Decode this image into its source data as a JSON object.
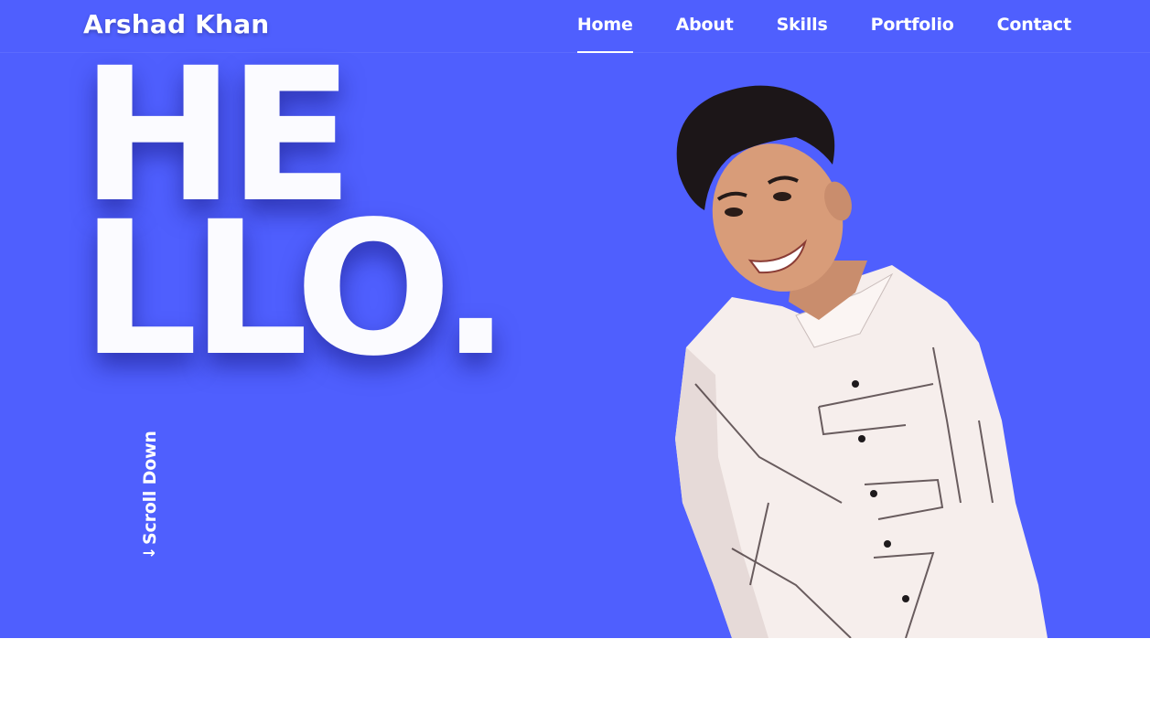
{
  "nav": {
    "brand": "Arshad Khan",
    "links": [
      {
        "label": "Home",
        "active": true
      },
      {
        "label": "About",
        "active": false
      },
      {
        "label": "Skills",
        "active": false
      },
      {
        "label": "Portfolio",
        "active": false
      },
      {
        "label": "Contact",
        "active": false
      }
    ]
  },
  "hero": {
    "line1": "HE",
    "line2": "LLO.",
    "scroll_label": "Scroll Down",
    "scroll_icon": "arrow-down-icon"
  },
  "colors": {
    "hero_bg": "#4f5ffe",
    "text": "#ffffff"
  }
}
